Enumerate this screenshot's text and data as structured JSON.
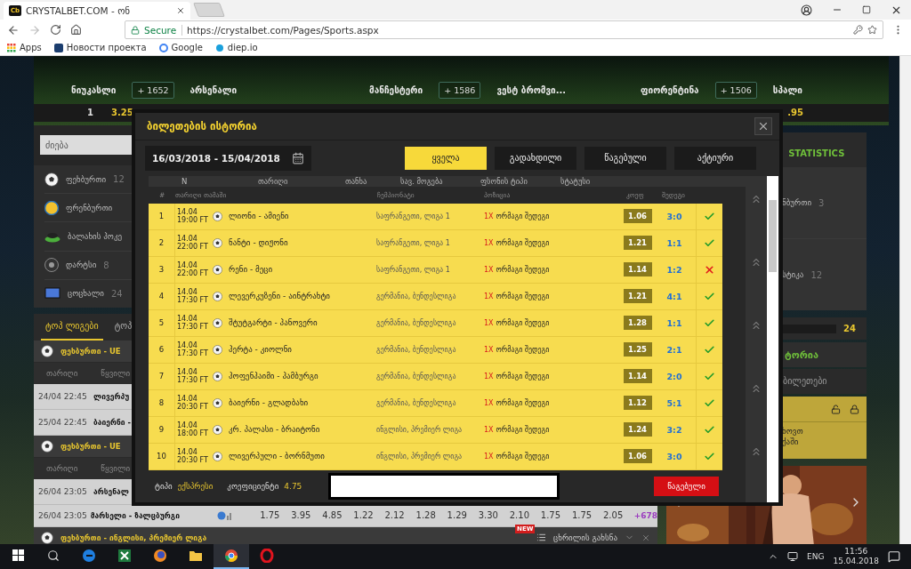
{
  "browser": {
    "favicon_text": "Cb",
    "tab_title": "CRYSTALBET.COM - ონ",
    "secure_label": "Secure",
    "url": "https://crystalbet.com/Pages/Sports.aspx",
    "bookmarks": [
      {
        "label": "Apps",
        "kind": "apps"
      },
      {
        "label": "Новости проекта",
        "kind": "news"
      },
      {
        "label": "Google",
        "kind": "google"
      },
      {
        "label": "diep.io",
        "kind": "diep"
      }
    ]
  },
  "match_strip": {
    "matches": [
      {
        "home": "ნიუკასლი",
        "count": "+ 1652",
        "away": "არსენალი"
      },
      {
        "home": "მანჩესტერი",
        "count": "+ 1586",
        "away": "ვესტ ბრომვი..."
      },
      {
        "home": "ფიორენტინა",
        "count": "+ 1506",
        "away": "სპალი"
      }
    ],
    "odds": {
      "label": "1",
      "value": "3.25",
      "tail": ".95"
    }
  },
  "sidebar": {
    "search_placeholder": "ძიება",
    "sports": [
      {
        "name": "ფეხბურთი",
        "count": "12",
        "kind": "football"
      },
      {
        "name": "ფრენბურთი",
        "kind": "volleyball"
      },
      {
        "name": "ბალახის ჰოკე",
        "kind": "hockey"
      },
      {
        "name": "დარტსი",
        "count": "8",
        "kind": "darts"
      },
      {
        "name": "ცოცხალი",
        "count": "24",
        "kind": "live"
      }
    ]
  },
  "league_tabs": [
    {
      "label": "ტოპ ლიგები",
      "selected": true
    },
    {
      "label": "ტოპ",
      "selected": false
    }
  ],
  "league_sections": [
    {
      "title": "ფეხბურთი - UE",
      "columns": [
        "თარიღი",
        "წყვილი"
      ],
      "rows": [
        {
          "time": "24/04 22:45",
          "match": "ლივერპუ"
        },
        {
          "time": "25/04 22:45",
          "match": "ბაიერნი -"
        }
      ]
    },
    {
      "title": "ფეხბურთი - UE",
      "columns": [
        "თარიღი",
        "წყვილი"
      ],
      "rows": [
        {
          "time": "26/04 23:05",
          "match": "არსენალ"
        },
        {
          "time": "26/04 23:05",
          "match": "მარსელი - ზალცბურგი",
          "odds": [
            "1.75",
            "3.95",
            "4.85",
            "1.22",
            "2.12",
            "1.28",
            "1.29",
            "3.30",
            "2.10",
            "1.75",
            "1.75",
            "2.05"
          ],
          "more": "+678"
        }
      ]
    },
    {
      "title": "ფეხბურთი - ინგლისი, პრემიერ ლიგა",
      "badge": "NEW",
      "action": "ცხრილის გახსნა"
    }
  ],
  "right_panel": {
    "tab": "STATISTICS",
    "sports": [
      {
        "name": "ნბურთი",
        "count": "3"
      },
      {
        "name": "სტიკა",
        "count": "12"
      }
    ],
    "counter": "24",
    "history_title": "ტორია",
    "tickets_label": "ბილეთები",
    "notice_lines": [
      "ხოვთ",
      "ქაში"
    ],
    "banner": {
      "kind": "picture"
    }
  },
  "modal": {
    "title": "ბილეთების ისტორია",
    "date_range": "16/03/2018 - 15/04/2018",
    "filters": [
      {
        "label": "ყველა",
        "selected": true
      },
      {
        "label": "გადახდილი",
        "selected": false
      },
      {
        "label": "წაგებული",
        "selected": false
      },
      {
        "label": "აქტიური",
        "selected": false
      }
    ],
    "columns": [
      "N",
      "თარიღი",
      "თანხა",
      "სავ. მოგება",
      "ფსონის ტიპი",
      "სტატუსი"
    ],
    "sub_columns": [
      "#",
      "თარიღი",
      "თამაში",
      "ჩემპიონატი",
      "პოზიცია",
      "კოეფ",
      "შედეგი"
    ],
    "rows": [
      {
        "n": "1",
        "date": "14.04",
        "time": "19:00 FT",
        "match": "ლიონი - ამიენი",
        "championship": "საფრანგეთი, ლიგა 1",
        "pick": "1X",
        "position": "ორმაგი შედეგი",
        "coef": "1.06",
        "score": "3:0",
        "won": true
      },
      {
        "n": "2",
        "date": "14.04",
        "time": "22:00 FT",
        "match": "ნანტი - დიჟონი",
        "championship": "საფრანგეთი, ლიგა 1",
        "pick": "1X",
        "position": "ორმაგი შედეგი",
        "coef": "1.21",
        "score": "1:1",
        "won": true
      },
      {
        "n": "3",
        "date": "14.04",
        "time": "22:00 FT",
        "match": "რენი - მეცი",
        "championship": "საფრანგეთი, ლიგა 1",
        "pick": "1X",
        "position": "ორმაგი შედეგი",
        "coef": "1.14",
        "score": "1:2",
        "won": false
      },
      {
        "n": "4",
        "date": "14.04",
        "time": "17:30 FT",
        "match": "ლევერკუზენი - აინტრახტი",
        "championship": "გერმანია, ბუნდესლიგა",
        "pick": "1X",
        "position": "ორმაგი შედეგი",
        "coef": "1.21",
        "score": "4:1",
        "won": true
      },
      {
        "n": "5",
        "date": "14.04",
        "time": "17:30 FT",
        "match": "შტუტგარტი - ჰანოვერი",
        "championship": "გერმანია, ბუნდესლიგა",
        "pick": "1X",
        "position": "ორმაგი შედეგი",
        "coef": "1.28",
        "score": "1:1",
        "won": true
      },
      {
        "n": "6",
        "date": "14.04",
        "time": "17:30 FT",
        "match": "ჰერტა - კიოლნი",
        "championship": "გერმანია, ბუნდესლიგა",
        "pick": "1X",
        "position": "ორმაგი შედეგი",
        "coef": "1.25",
        "score": "2:1",
        "won": true
      },
      {
        "n": "7",
        "date": "14.04",
        "time": "17:30 FT",
        "match": "ჰოფენჰაიმი - ჰამბურგი",
        "championship": "გერმანია, ბუნდესლიგა",
        "pick": "1X",
        "position": "ორმაგი შედეგი",
        "coef": "1.14",
        "score": "2:0",
        "won": true
      },
      {
        "n": "8",
        "date": "14.04",
        "time": "20:30 FT",
        "match": "ბაიერნი - გლადბახი",
        "championship": "გერმანია, ბუნდესლიგა",
        "pick": "1X",
        "position": "ორმაგი შედეგი",
        "coef": "1.12",
        "score": "5:1",
        "won": true
      },
      {
        "n": "9",
        "date": "14.04",
        "time": "18:00 FT",
        "match": "კრ. პალასი - ბრაიტონი",
        "championship": "ინგლისი, პრემიერ ლიგა",
        "pick": "1X",
        "position": "ორმაგი შედეგი",
        "coef": "1.24",
        "score": "3:2",
        "won": true
      },
      {
        "n": "10",
        "date": "14.04",
        "time": "20:30 FT",
        "match": "ლივერპული - ბორნმუთი",
        "championship": "ინგლისი, პრემიერ ლიგა",
        "pick": "1X",
        "position": "ორმაგი შედეგი",
        "coef": "1.06",
        "score": "3:0",
        "won": true
      }
    ],
    "footer": {
      "type_label": "ტიპი",
      "type_value": "ექსპრესი",
      "coef_label": "კოეფიციენტი",
      "coef_value": "4.75",
      "status": "წაგებული"
    }
  },
  "taskbar": {
    "apps": [
      {
        "kind": "edge",
        "active": false
      },
      {
        "kind": "excel",
        "active": false
      },
      {
        "kind": "firefox",
        "active": false
      },
      {
        "kind": "folder",
        "active": false
      },
      {
        "kind": "chrome",
        "active": true
      },
      {
        "kind": "opera",
        "active": false
      }
    ],
    "language": "ENG",
    "time": "11:56",
    "date": "15.04.2018"
  }
}
